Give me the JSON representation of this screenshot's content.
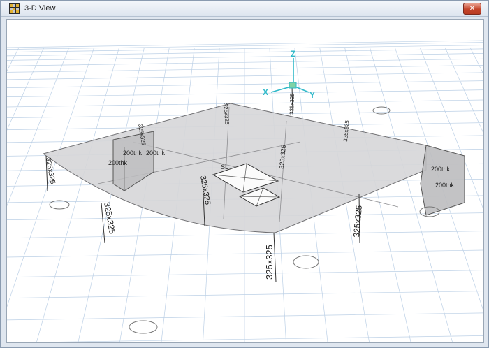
{
  "window": {
    "title": "3-D View",
    "close_glyph": "✕",
    "app_icon": "grid-app-icon"
  },
  "model": {
    "axes": {
      "x": "X",
      "y": "Y",
      "z": "Z"
    },
    "column_section": "325x325",
    "wall_thickness": "200thk",
    "slab_label": "SL"
  },
  "colors": {
    "grid": "#bcd0e6",
    "slab_fill": "#d6d6d8",
    "wall_fill": "#bdbdbf",
    "axis": "#2fb9c9"
  }
}
